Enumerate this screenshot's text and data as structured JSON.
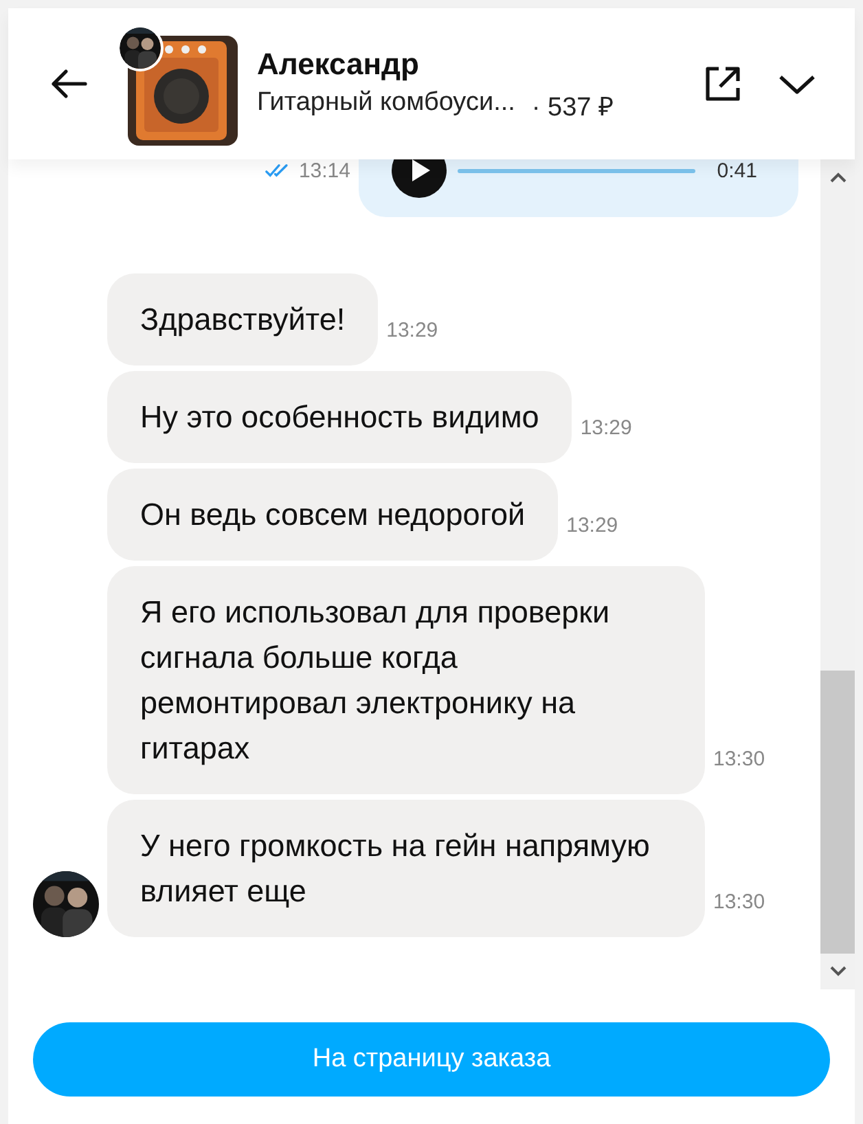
{
  "header": {
    "name": "Александр",
    "product": "Гитарный комбоуси...",
    "price": "· 537 ₽"
  },
  "messages": [
    {
      "kind": "voice",
      "duration": "0:41",
      "time": "13:14",
      "read": true
    },
    {
      "kind": "text",
      "text": "Здравствуйте!",
      "time": "13:29",
      "avatar": false
    },
    {
      "kind": "text",
      "text": "Ну это особенность видимо",
      "time": "13:29",
      "avatar": false
    },
    {
      "kind": "text",
      "text": "Он ведь совсем недорогой",
      "time": "13:29",
      "avatar": false
    },
    {
      "kind": "text",
      "text": "Я его использовал для проверки сигнала больше когда ремонтировал электронику на гитарах",
      "time": "13:30",
      "avatar": false
    },
    {
      "kind": "text",
      "text": "У него громкость на гейн напрямую влияет еще",
      "time": "13:30",
      "avatar": true
    }
  ],
  "order_button": "На страницу заказа"
}
